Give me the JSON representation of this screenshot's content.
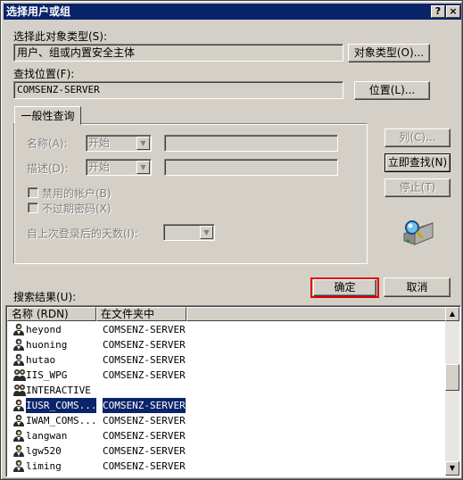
{
  "window": {
    "title": "选择用户或组",
    "help_glyph": "?",
    "close_glyph": "×"
  },
  "object_type": {
    "label": "选择此对象类型(S):",
    "value": "用户、组或内置安全主体",
    "button": "对象类型(O)..."
  },
  "location": {
    "label": "查找位置(F):",
    "value": "COMSENZ-SERVER",
    "button": "位置(L)..."
  },
  "query": {
    "tab": "一般性查询",
    "name_label": "名称(A):",
    "name_mode": "开始",
    "desc_label": "描述(D):",
    "desc_mode": "开始",
    "disabled_accounts": "禁用的帐户(B)",
    "non_expiring": "不过期密码(X)",
    "days_label": "自上次登录后的天数(I):"
  },
  "side_buttons": {
    "columns": "列(C)...",
    "find_now": "立即查找(N)",
    "stop": "停止(T)"
  },
  "dialog_buttons": {
    "ok": "确定",
    "cancel": "取消"
  },
  "results": {
    "label": "搜索结果(U):",
    "columns": [
      "名称 (RDN)",
      "在文件夹中"
    ],
    "rows": [
      {
        "name": "heyond",
        "folder": "COMSENZ-SERVER",
        "icon": "user-icon",
        "selected": false
      },
      {
        "name": "huoning",
        "folder": "COMSENZ-SERVER",
        "icon": "user-icon",
        "selected": false
      },
      {
        "name": "hutao",
        "folder": "COMSENZ-SERVER",
        "icon": "user-icon",
        "selected": false
      },
      {
        "name": "IIS_WPG",
        "folder": "COMSENZ-SERVER",
        "icon": "group-icon",
        "selected": false
      },
      {
        "name": "INTERACTIVE",
        "folder": "",
        "icon": "group-icon",
        "selected": false
      },
      {
        "name": "IUSR_COMS...",
        "folder": "COMSENZ-SERVER",
        "icon": "user-icon",
        "selected": true
      },
      {
        "name": "IWAM_COMS...",
        "folder": "COMSENZ-SERVER",
        "icon": "user-icon",
        "selected": false
      },
      {
        "name": "langwan",
        "folder": "COMSENZ-SERVER",
        "icon": "user-icon",
        "selected": false
      },
      {
        "name": "lgw520",
        "folder": "COMSENZ-SERVER",
        "icon": "user-icon",
        "selected": false
      },
      {
        "name": "liming",
        "folder": "COMSENZ-SERVER",
        "icon": "user-icon",
        "selected": false
      }
    ]
  },
  "colors": {
    "titlebar": "#0a246a",
    "face": "#d4d0c8",
    "highlight_box": "#e00000",
    "selection": "#0a246a"
  }
}
